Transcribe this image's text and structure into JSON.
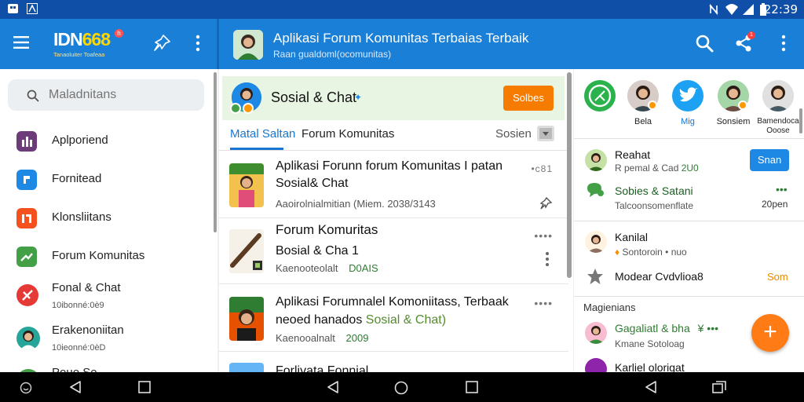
{
  "status_bar": {
    "time": "22:39"
  },
  "app_bar": {
    "logo_text_main": "IDN",
    "logo_text_accent": "668",
    "logo_badge": "h",
    "logo_tagline": "Tanaoluiter Toafeaa",
    "title": "Aplikasi Forum Komunitas Terbaias Terbaik",
    "subtitle": "Raan gualdoml(ocomunitas)",
    "share_badge": "1"
  },
  "sidebar": {
    "search_placeholder": "Maladnitans",
    "items": [
      {
        "label": "Aplporiend",
        "sub": "",
        "color": "#6d3b7a"
      },
      {
        "label": "Fornitead",
        "sub": "",
        "color": "#1e88e5"
      },
      {
        "label": "Klonsliitans",
        "sub": "",
        "color": "#f4511e"
      },
      {
        "label": "Forum Komunitas",
        "sub": "",
        "color": "#43a047"
      },
      {
        "label": "Fonal & Chat",
        "sub": "10ibonné:0è9",
        "color": "#e53935"
      },
      {
        "label": "Erakenoniitan",
        "sub": "10ieonné:0èD",
        "color": "#26a69a"
      },
      {
        "label": "Poue Se",
        "sub": "",
        "color": "#43a047"
      }
    ]
  },
  "middle": {
    "group_title": "Sosial & Chat",
    "group_button": "Solbes",
    "tab_active": "Matal Saltan",
    "tab_second": "Forum Komunitas",
    "tab_right": "Sosien",
    "posts": [
      {
        "title": "Aplikasi Forunn forum Komunitas I patan Sosial& Chat",
        "meta": "Aaoirolnialmitian (Miem. 2038/3143",
        "meta_green": "",
        "corner": "•c81"
      },
      {
        "title": "Forum Komuritas",
        "title2": "Bosial & Cha 1",
        "meta": "Kaenooteolalt",
        "meta_green": "D0AIS",
        "corner": "••••"
      },
      {
        "title": "Aplikasi Forumnalel Komoniitass, Terbaak",
        "title_line2": "neoed hanados",
        "title_line2_green": "Sosial & Chat)",
        "meta": "Kaenooalnalt",
        "meta_green": "2009",
        "corner": "••••"
      },
      {
        "title": "Forlivata Fonnial",
        "meta": "",
        "meta_green": "",
        "corner": ""
      }
    ]
  },
  "right": {
    "stories": [
      {
        "name": "",
        "kind": "whatsapp"
      },
      {
        "name": "Bela",
        "kind": "person"
      },
      {
        "name": "Mig",
        "kind": "twitter"
      },
      {
        "name": "Sonsiem",
        "kind": "person"
      },
      {
        "name": "Bamendoca Ooose",
        "kind": "person"
      }
    ],
    "rows": [
      {
        "title": "Reahat",
        "sub": "R pemal & Cad",
        "sub_green": "2U0",
        "button": "Snan"
      },
      {
        "title": "Sobies & Satani",
        "sub": "Talcoonsomenflate",
        "right_green": "•••",
        "right_text": "20pen"
      },
      {
        "title": "Kanilal",
        "sub": "Sontoroin • nuo",
        "sub_prefix": "♦"
      },
      {
        "title": "Modear Cvdvlioa8",
        "right_orange": "Som"
      },
      {
        "section": "Magienians"
      },
      {
        "title": "Gagaliatl & bha",
        "title_green": "¥ •••",
        "sub": "Kmane Sotoloag"
      },
      {
        "title": "Karliel olorigat"
      }
    ],
    "fab_label": "+"
  }
}
